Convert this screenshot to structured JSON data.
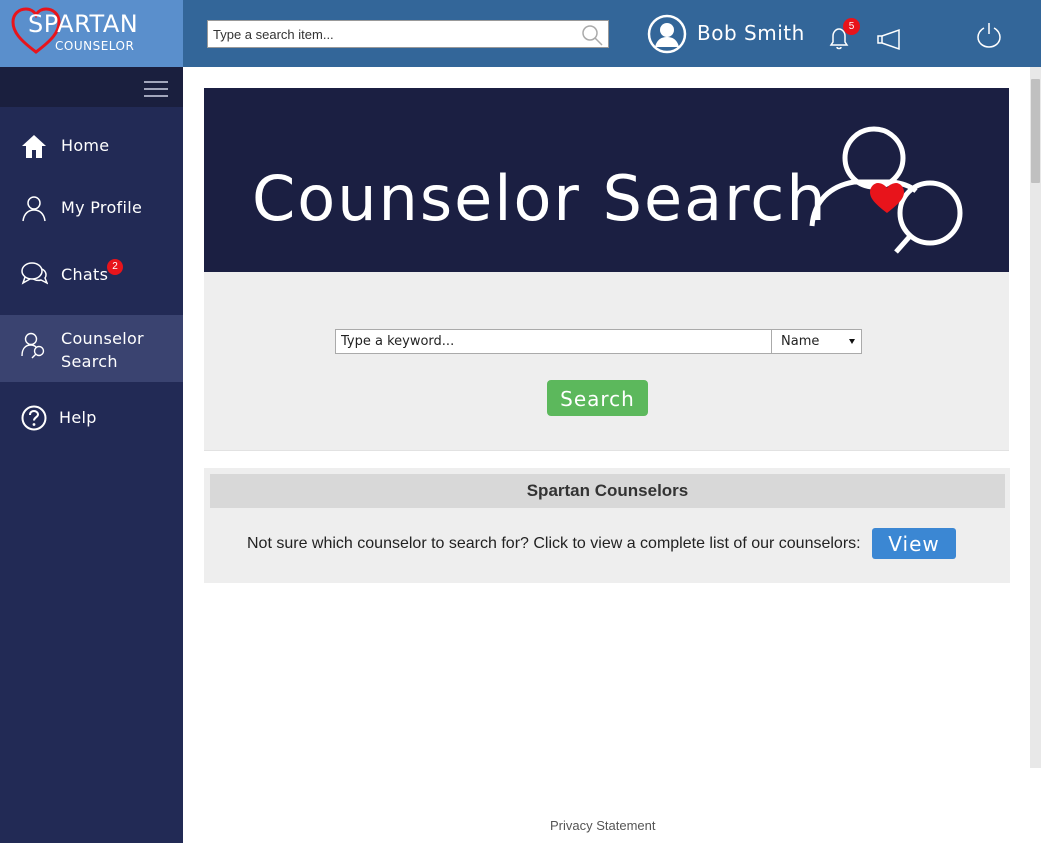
{
  "brand": {
    "logo_line1": "SPARTAN",
    "logo_line2": "COUNSELOR",
    "heart_color": "#e8141b"
  },
  "header": {
    "search_placeholder": "Type a search item...",
    "user_name": "Bob Smith",
    "notification_count": "5",
    "icons": [
      "search-icon",
      "user-avatar-icon",
      "bell-icon",
      "megaphone-icon",
      "power-icon"
    ]
  },
  "sidebar": {
    "items": [
      {
        "label": "Home",
        "icon": "home-icon",
        "active": false
      },
      {
        "label": "My Profile",
        "icon": "user-icon",
        "active": false
      },
      {
        "label": "Chats",
        "icon": "chat-bubbles-icon",
        "badge": "2",
        "active": false
      },
      {
        "label": "Counselor",
        "label2": "Search",
        "icon": "counselor-search-icon",
        "active": true
      },
      {
        "label": "Help",
        "icon": "help-icon",
        "active": false
      }
    ]
  },
  "hero": {
    "title": "Counselor Search"
  },
  "search": {
    "keyword_placeholder": "Type a keyword...",
    "filter_selected": "Name",
    "button_label": "Search"
  },
  "counselors": {
    "header": "Spartan Counselors",
    "prompt": "Not sure which counselor to search for? Click to view a complete list of our counselors:",
    "view_label": "View"
  },
  "footer": {
    "privacy": "Privacy Statement"
  },
  "colors": {
    "header_bg": "#336699",
    "logo_bg": "#5a8fcc",
    "sidebar_bg": "#222a55",
    "sidebar_active": "#3a4370",
    "hero_bg": "#1b1f42",
    "search_button": "#5cb85c",
    "view_button": "#3b87d3",
    "badge": "#e8141b"
  }
}
